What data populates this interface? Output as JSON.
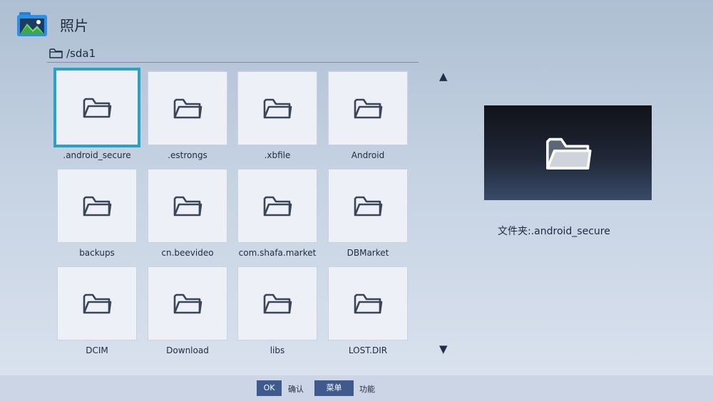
{
  "app": {
    "title": "照片"
  },
  "path": {
    "current": "/sda1"
  },
  "folders": [
    {
      "name": ".android_secure",
      "selected": true
    },
    {
      "name": ".estrongs"
    },
    {
      "name": ".xbfile"
    },
    {
      "name": "Android"
    },
    {
      "name": "backups"
    },
    {
      "name": "cn.beevideo"
    },
    {
      "name": "com.shafa.market"
    },
    {
      "name": "DBMarket"
    },
    {
      "name": "DCIM"
    },
    {
      "name": "Download"
    },
    {
      "name": "libs"
    },
    {
      "name": "LOST.DIR"
    }
  ],
  "scroll": {
    "up": "▲",
    "down": "▼"
  },
  "preview": {
    "info": "文件夹:.android_secure"
  },
  "footer": {
    "ok_key": "OK",
    "ok_desc": "确认",
    "menu_key": "菜单",
    "menu_desc": "功能"
  },
  "colors": {
    "accent": "#2aa1c8",
    "key_bg": "#3f5a8c",
    "tile_bg": "#edf0f7"
  },
  "icons": {
    "app": "gallery-app-icon",
    "folder": "folder-icon",
    "path": "folder-outline-icon"
  }
}
